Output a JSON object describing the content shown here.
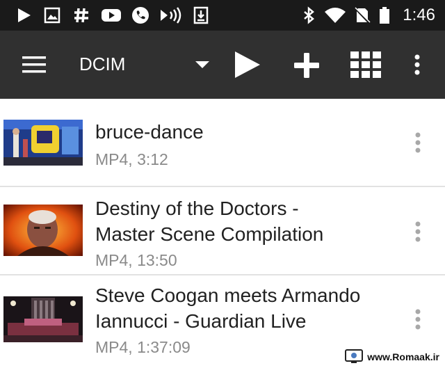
{
  "status_bar": {
    "time": "1:46",
    "icons": [
      "play-store-icon",
      "image-icon",
      "hashtag-icon",
      "youtube-icon",
      "phone-call-icon",
      "nfc-icon",
      "download-icon",
      "bluetooth-icon",
      "wifi-icon",
      "no-sim-icon",
      "battery-icon"
    ]
  },
  "toolbar": {
    "folder_title": "DCIM",
    "icons": [
      "menu-icon",
      "dropdown-arrow-icon",
      "play-icon",
      "add-icon",
      "grid-view-icon",
      "overflow-menu-icon"
    ],
    "background_color": "#303030"
  },
  "videos": [
    {
      "title_lines": [
        "bruce-dance"
      ],
      "meta": "MP4, 3:12"
    },
    {
      "title_lines": [
        "Destiny of the Doctors -",
        "Master Scene Compilation"
      ],
      "meta": "MP4, 13:50"
    },
    {
      "title_lines": [
        "Steve Coogan meets Armando",
        "Iannucci - Guardian Live"
      ],
      "meta": "MP4, 1:37:09"
    }
  ],
  "watermark": {
    "text": "www.Romaak.ir"
  }
}
